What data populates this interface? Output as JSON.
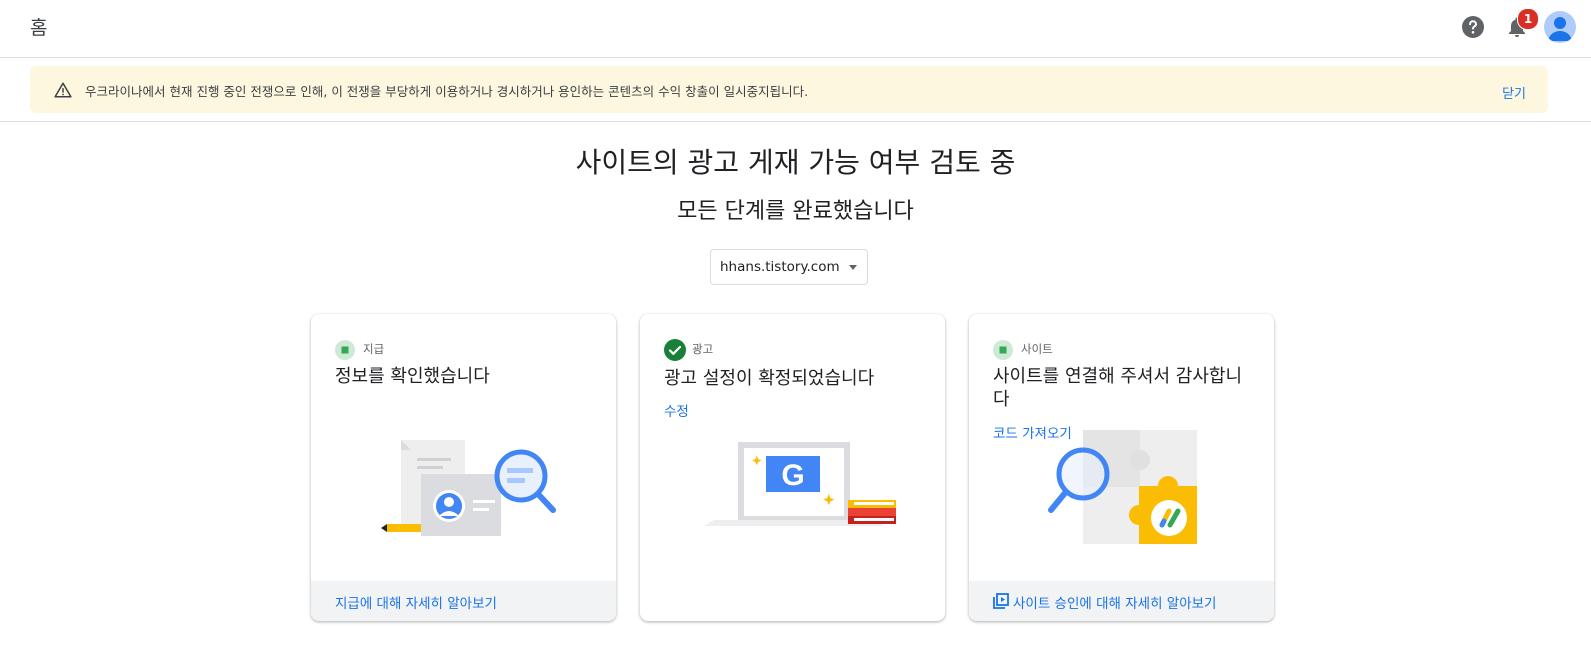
{
  "topbar": {
    "title": "홈",
    "notification_count": "1"
  },
  "banner": {
    "message": "우크라이나에서 현재 진행 중인 전쟁으로 인해, 이 전쟁을 부당하게 이용하거나 경시하거나 용인하는 콘텐츠의 수익 창출이 일시중지됩니다.",
    "close_label": "닫기"
  },
  "main": {
    "heading": "사이트의 광고 게재 가능 여부 검토 중",
    "subheading": "모든 단계를 완료했습니다",
    "site_selector": {
      "value": "hhans.tistory.com"
    }
  },
  "cards": [
    {
      "status_label": "지급",
      "title": "정보를 확인했습니다",
      "footer_link": "지급에 대해 자세히 알아보기"
    },
    {
      "status_label": "광고",
      "title": "광고 설정이 확정되었습니다",
      "action_link": "수정",
      "illo_letter": "G"
    },
    {
      "status_label": "사이트",
      "title": "사이트를 연결해 주셔서 감사합니다",
      "action_link": "코드 가져오기",
      "footer_link": "사이트 승인에 대해 자세히 알아보기"
    }
  ],
  "colors": {
    "accent": "#1a73e8",
    "success": "#188038",
    "banner_bg": "#fef7e0",
    "badge": "#d93025"
  }
}
